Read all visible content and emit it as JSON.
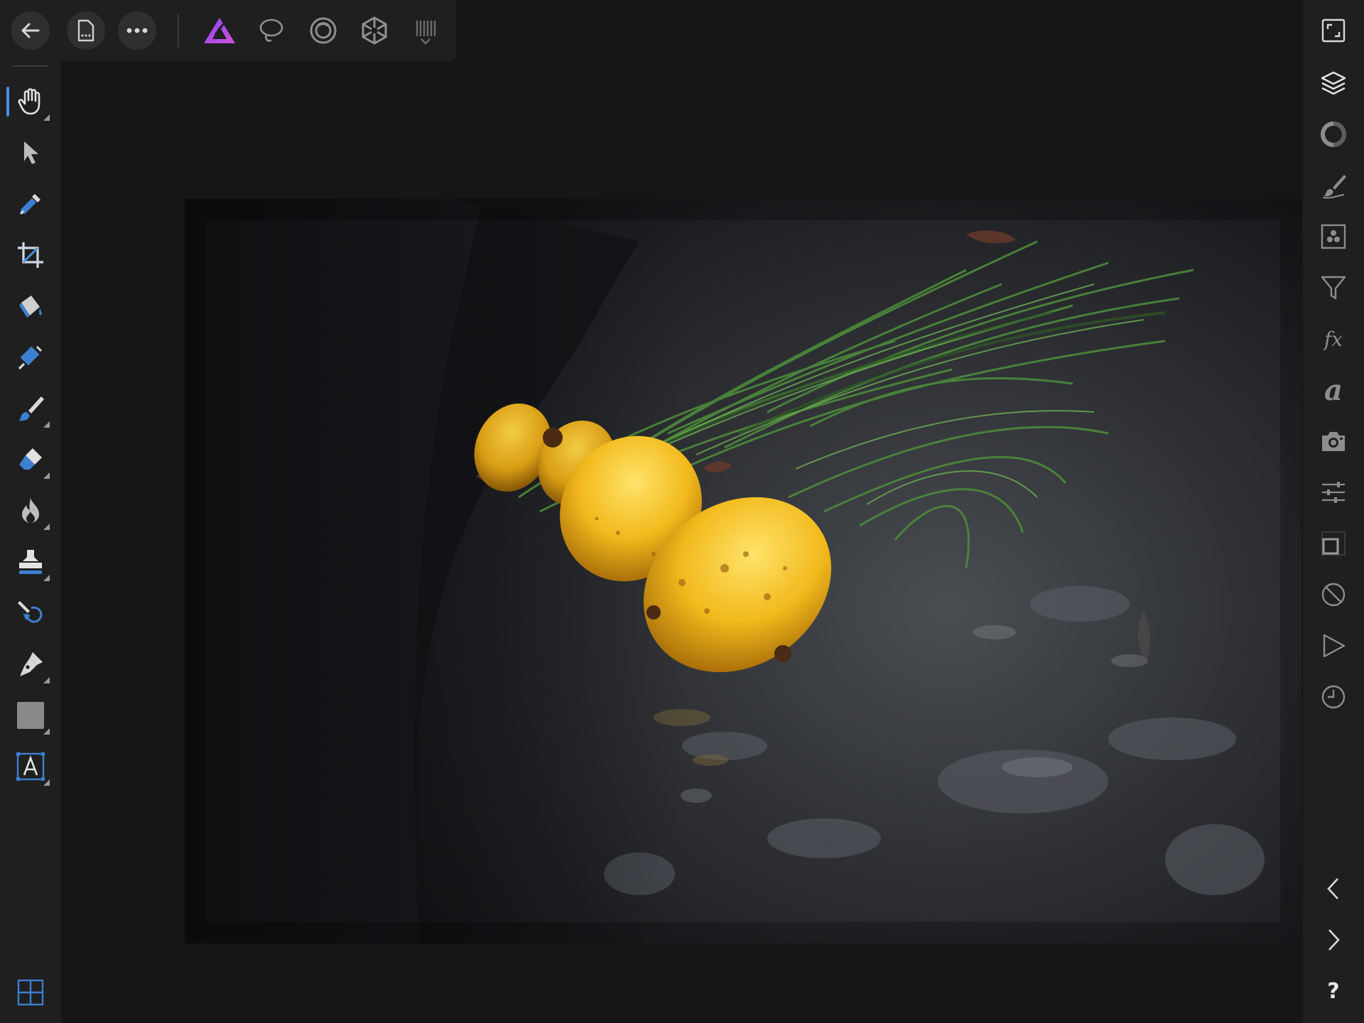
{
  "app": {
    "name": "Affinity Photo",
    "accent": "#4a90e2",
    "brand_gradient": [
      "#7b3fe4",
      "#c84fd8"
    ]
  },
  "topbar": {
    "buttons": [
      {
        "icon": "back-arrow-icon"
      },
      {
        "icon": "document-icon"
      },
      {
        "icon": "more-icon"
      }
    ],
    "personas": [
      {
        "icon": "photo-persona-icon",
        "active": true
      },
      {
        "icon": "liquify-persona-icon"
      },
      {
        "icon": "develop-persona-icon"
      },
      {
        "icon": "tone-mapping-persona-icon"
      },
      {
        "icon": "export-persona-icon"
      }
    ]
  },
  "tools": [
    {
      "icon": "hand-icon",
      "active": true,
      "has_flyout": true
    },
    {
      "icon": "move-arrow-icon",
      "has_flyout": false
    },
    {
      "icon": "color-picker-icon",
      "has_flyout": false
    },
    {
      "icon": "crop-icon",
      "has_flyout": false
    },
    {
      "icon": "fill-bucket-icon",
      "has_flyout": false
    },
    {
      "icon": "selection-brush-icon",
      "has_flyout": false
    },
    {
      "icon": "paint-brush-icon",
      "has_flyout": true
    },
    {
      "icon": "eraser-icon",
      "has_flyout": true
    },
    {
      "icon": "burn-flame-icon",
      "has_flyout": true
    },
    {
      "icon": "clone-stamp-icon",
      "has_flyout": true
    },
    {
      "icon": "undo-brush-icon",
      "has_flyout": false
    },
    {
      "icon": "pen-icon",
      "has_flyout": true
    },
    {
      "icon": "rectangle-shape-icon",
      "has_flyout": true
    },
    {
      "icon": "text-frame-icon",
      "has_flyout": true
    }
  ],
  "bottom_left": {
    "icon": "grid-layout-icon"
  },
  "studio": {
    "fx_label": "fx",
    "text_label": "a",
    "help_label": "?",
    "icons": [
      "fullscreen-icon",
      "layers-icon",
      "adjustments-icon",
      "brushes-icon",
      "channels-icon",
      "filters-icon",
      "fx-icon",
      "text-styles-icon",
      "camera-icon",
      "adjust-sliders-icon",
      "transform-icon",
      "mask-circle-icon",
      "play-macro-icon",
      "history-clock-icon",
      "chevron-left-icon",
      "chevron-right-icon",
      "help-icon"
    ]
  },
  "canvas": {
    "image_subject": "quince-fruits-on-rock"
  }
}
